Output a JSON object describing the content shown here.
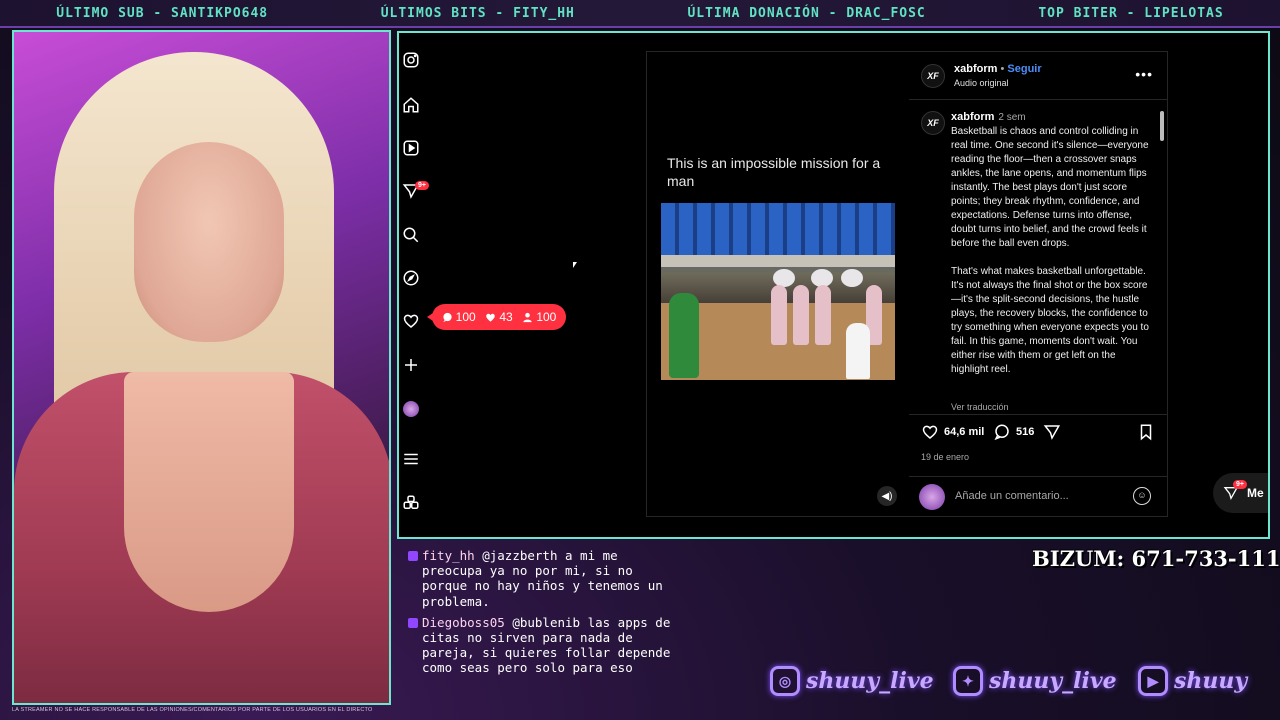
{
  "topbar": {
    "last_sub": "ÚLTIMO SUB - SANTIKPO648",
    "last_bits": "ÚLTIMOS BITS - FITY_HH",
    "last_donation": "ÚLTIMA DONACIÓN - DRAC_FOSC",
    "top_biter": "TOP BITER - LIPELOTAS"
  },
  "disclaimer": "LA STREAMER NO SE HACE RESPONSABLE DE LAS OPINIONES/COMENTARIOS POR PARTE DE LOS USUARIOS EN EL DIRECTO",
  "instagram": {
    "nav_badge": "9+",
    "notif_pill": {
      "comments": "100",
      "likes": "43",
      "follows": "100"
    },
    "post": {
      "video_caption": "This is an impossible mission for a man",
      "author": "xabform",
      "logo_text": "XF",
      "separator": "•",
      "follow_label": "Seguir",
      "audio_label": "Audio original",
      "more_label": "•••",
      "comment_time": "2 sem",
      "comment_text": "Basketball is chaos and control colliding in real time. One second it's silence—everyone reading the floor—then a crossover snaps ankles, the lane opens, and momentum flips instantly. The best plays don't just score points; they break rhythm, confidence, and expectations. Defense turns into offense, doubt turns into belief, and the crowd feels it before the ball even drops.\n\nThat's what makes basketball unforgettable. It's not always the final shot or the box score—it's the split-second decisions, the hustle plays, the recovery blocks, the confidence to try something when everyone expects you to fail. In this game, moments don't wait. You either rise with them or get left on the highlight reel.",
      "translate_label": "Ver traducción",
      "likes": "64,6 mil",
      "comments_count": "516",
      "date": "19 de enero",
      "add_comment_placeholder": "Añade un comentario..."
    },
    "messages": {
      "badge": "9+",
      "label": "Me"
    }
  },
  "chat": [
    {
      "user": "fity_hh",
      "text": " @jazzberth a mi me preocupa ya no por mi, si no porque no hay niños y tenemos un problema."
    },
    {
      "user": "Diegoboss05",
      "text": " @bublenib las apps de citas no sirven para nada de pareja, si quieres follar depende como seas pero solo para eso"
    }
  ],
  "bizum": "BIZUM: 671-733-111",
  "socials": [
    {
      "icon": "instagram-icon",
      "handle": "shuuy_live"
    },
    {
      "icon": "twitter-icon",
      "handle": "shuuy_live"
    },
    {
      "icon": "youtube-icon",
      "handle": "shuuy"
    }
  ],
  "colors": {
    "accent_teal": "#6de6cf",
    "ig_red": "#ff3040",
    "ig_link": "#4c8df6",
    "purple": "#9146ff"
  }
}
